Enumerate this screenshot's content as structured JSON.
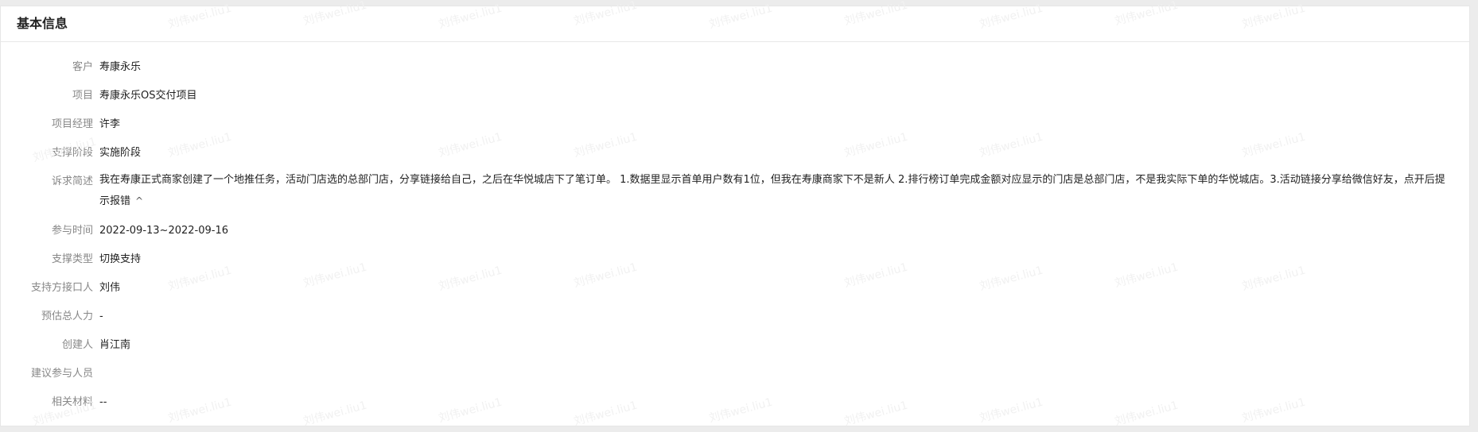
{
  "header": {
    "title": "基本信息"
  },
  "watermark": "刘伟wei.liu1",
  "fields": [
    {
      "label": "客户",
      "value": "寿康永乐"
    },
    {
      "label": "项目",
      "value": "寿康永乐OS交付项目"
    },
    {
      "label": "项目经理",
      "value": "许李"
    },
    {
      "label": "支撑阶段",
      "value": "实施阶段"
    },
    {
      "label": "诉求简述",
      "value": "我在寿康正式商家创建了一个地推任务，活动门店选的总部门店，分享链接给自己，之后在华悦城店下了笔订单。 1.数据里显示首单用户数有1位，但我在寿康商家下不是新人 2.排行榜订单完成金额对应显示的门店是总部门店，不是我实际下单的华悦城店。3.活动链接分享给微信好友，点开后提示报错",
      "toggle": "^"
    },
    {
      "label": "参与时间",
      "value": "2022-09-13~2022-09-16"
    },
    {
      "label": "支撑类型",
      "value": "切换支持"
    },
    {
      "label": "支持方接口人",
      "value": "刘伟"
    },
    {
      "label": "预估总人力",
      "value": "-"
    },
    {
      "label": "创建人",
      "value": "肖江南"
    },
    {
      "label": "建议参与人员",
      "value": ""
    },
    {
      "label": "相关材料",
      "value": "--"
    }
  ]
}
